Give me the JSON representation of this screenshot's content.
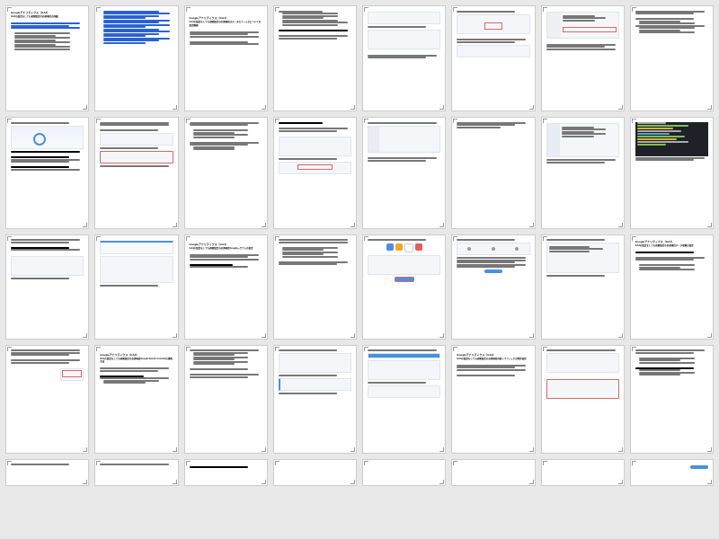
{
  "pages": [
    {
      "type": "toc",
      "heading": "Googleアナリティクス（GA4）",
      "sub": "GA4の設定をしても初期設定の必須項目の詳細"
    },
    {
      "type": "toc_links"
    },
    {
      "type": "section",
      "heading": "Googleアナリティクス（GA4）",
      "sub": "GA4の設定をしても初期設定の必須項目はデータのフィルタについての設定概要"
    },
    {
      "type": "text_img",
      "img": "md"
    },
    {
      "type": "split_img"
    },
    {
      "type": "ui_form",
      "red": true
    },
    {
      "type": "ui_left"
    },
    {
      "type": "text_bullets"
    },
    {
      "type": "map_text"
    },
    {
      "type": "text_img",
      "img": "md",
      "red": true
    },
    {
      "type": "text_short"
    },
    {
      "type": "ui_list"
    },
    {
      "type": "ui_panel"
    },
    {
      "type": "text_min"
    },
    {
      "type": "ui_sidebar"
    },
    {
      "type": "code"
    },
    {
      "type": "map_page"
    },
    {
      "type": "ui_form2"
    },
    {
      "type": "section2",
      "heading": "Googleアナリティクス（GA4）",
      "sub": "GA4の設定をしても初期設定の必須項目Googleシグナルの設定"
    },
    {
      "type": "text_bullets2"
    },
    {
      "type": "icons"
    },
    {
      "type": "wizard"
    },
    {
      "type": "ui_card"
    },
    {
      "type": "section3",
      "heading": "Googleアナリティクス（GA4）",
      "sub": "GA4の設定をしても初期設定の必須項目データ収集の設定"
    },
    {
      "type": "text_img_red"
    },
    {
      "type": "section4",
      "heading": "Googleアナリティクス（GA4）",
      "sub": "GA4の設定をしても初期設定の必須項目Google Search Consoleの連携方法"
    },
    {
      "type": "text_bullets3"
    },
    {
      "type": "ui_form3"
    },
    {
      "type": "ui_blue"
    },
    {
      "type": "section5",
      "heading": "Googleアナリティクス（GA4）",
      "sub": "GA4の設定をしても初期設定の必須項目内部トラフィックの除外設定"
    },
    {
      "type": "ui_red_outline"
    },
    {
      "type": "text_bullets4"
    },
    {
      "type": "partial"
    },
    {
      "type": "partial2"
    },
    {
      "type": "partial3"
    },
    {
      "type": "partial4"
    },
    {
      "type": "partial5"
    },
    {
      "type": "partial6"
    },
    {
      "type": "partial7"
    },
    {
      "type": "partial_blue"
    }
  ]
}
